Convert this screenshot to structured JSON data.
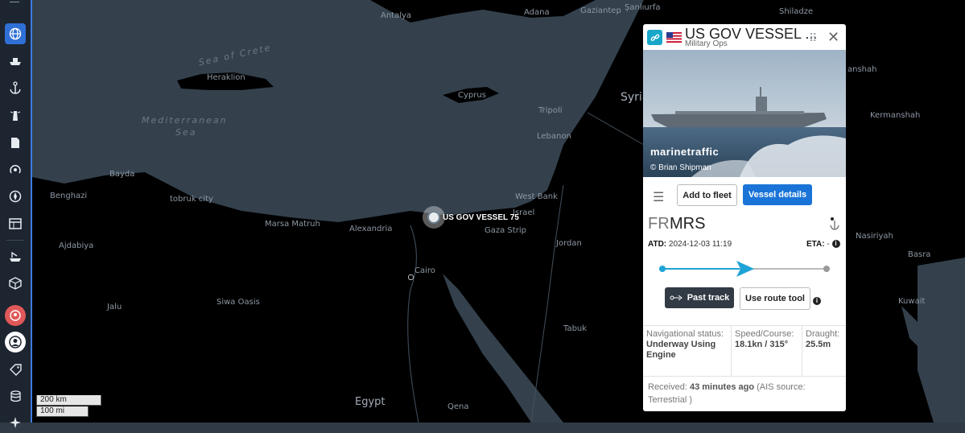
{
  "sidebar": {
    "items": [
      {
        "name": "map-layers",
        "glyph": "⊕"
      },
      {
        "name": "vessels",
        "glyph": "⛴"
      },
      {
        "name": "ports",
        "glyph": "⚓"
      },
      {
        "name": "lighthouses",
        "glyph": "⚑"
      },
      {
        "name": "documents",
        "glyph": "▤"
      },
      {
        "name": "signal",
        "glyph": "◎"
      },
      {
        "name": "compass",
        "glyph": "✪"
      },
      {
        "name": "table",
        "glyph": "▦"
      },
      {
        "name": "ship-route",
        "glyph": "⛵"
      },
      {
        "name": "package",
        "glyph": "▣"
      },
      {
        "name": "alerts",
        "glyph": "●"
      },
      {
        "name": "account",
        "glyph": "◉"
      },
      {
        "name": "tags",
        "glyph": "⌂"
      },
      {
        "name": "database",
        "glyph": "≡"
      },
      {
        "name": "more",
        "glyph": "✦"
      }
    ]
  },
  "map": {
    "labels": {
      "antalya": "Antalya",
      "adana": "Adana",
      "gaziantep": "Gaziantep",
      "sanliurfa": "Şanlıurfa",
      "shiladze": "Shiladze",
      "sea_of_crete": "Sea of Crete",
      "heraklion": "Heraklion",
      "cyprus": "Cyprus",
      "mediterranean": "Mediterranean",
      "sea": "Sea",
      "syria": "Syria",
      "tripoli": "Tripoli",
      "lebanon": "Lebanon",
      "kermanshah": "Kermanshah",
      "anshah": "anshah",
      "bayda": "Bayda",
      "benghazi": "Benghazi",
      "tobruk": "tobruk city",
      "marsa_matruh": "Marsa Matruh",
      "alexandria": "Alexandria",
      "west_bank": "West Bank",
      "israel": "Israel",
      "gaza": "Gaza Strip",
      "jordan": "Jordan",
      "ajdabiya": "Ajdabiya",
      "cairo": "Cairo",
      "jalu": "Jalu",
      "siwa": "Siwa Oasis",
      "tabuk": "Tabuk",
      "kuwait": "Kuwait",
      "nasiriyah": "Nasiriyah",
      "basra": "Basra",
      "egypt": "Egypt",
      "qena": "Qena"
    },
    "scale": {
      "km": "200 km",
      "mi": "100 mi"
    },
    "vessel_label": "US GOV VESSEL 75"
  },
  "panel": {
    "title": "US GOV VESSEL ...",
    "subtitle": "Military Ops",
    "photo_brand": "marinetraffic",
    "photo_credit": "© Brian Shipman",
    "add_fleet": "Add to fleet",
    "vessel_details": "Vessel details",
    "dest_country": "FR",
    "dest_port": "MRS",
    "atd_label": "ATD:",
    "atd_value": "2024-12-03 11:19",
    "eta_label": "ETA:",
    "eta_value": "-",
    "past_track": "Past track",
    "route_tool": "Use route tool",
    "nav_label": "Navigational status:",
    "nav_value": "Underway Using Engine",
    "speed_label": "Speed/Course:",
    "speed_value": "18.1kn / 315°",
    "draught_label": "Draught:",
    "draught_value": "25.5m",
    "received_label": "Received:",
    "received_value": "43 minutes ago",
    "ais_source": "(AIS source: Terrestrial )"
  },
  "colors": {
    "accent": "#1a74d8",
    "link": "#18a7c9",
    "progress": "#1ea3d6",
    "land": "#000000",
    "water": "#34414d"
  }
}
